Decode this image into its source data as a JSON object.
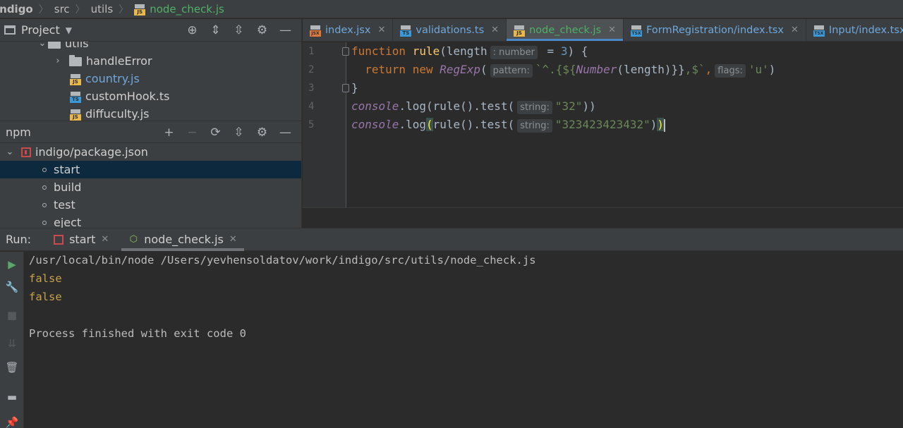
{
  "breadcrumb": {
    "items": [
      "indigo",
      "src",
      "utils",
      "node_check.js"
    ]
  },
  "project_panel": {
    "title": "Project",
    "tree": [
      {
        "label": "utils",
        "type": "folder"
      },
      {
        "label": "handleError",
        "type": "folder"
      },
      {
        "label": "country.js",
        "type": "js"
      },
      {
        "label": "customHook.ts",
        "type": "ts"
      },
      {
        "label": "diffuculty.js",
        "type": "js"
      }
    ]
  },
  "npm_panel": {
    "title": "npm",
    "package": "indigo/package.json",
    "scripts": [
      "start",
      "build",
      "test",
      "eject"
    ],
    "selected": "start"
  },
  "editor_tabs": [
    {
      "label": "index.jsx",
      "icon": "jsx-file-icon",
      "active": false
    },
    {
      "label": "validations.ts",
      "icon": "ts-file-icon",
      "active": false
    },
    {
      "label": "node_check.js",
      "icon": "js-file-icon",
      "active": true
    },
    {
      "label": "FormRegistration/index.tsx",
      "icon": "tsx-file-icon",
      "active": false
    },
    {
      "label": "Input/index.tsx",
      "icon": "tsx-file-icon",
      "active": false
    }
  ],
  "code": {
    "line_numbers": [
      "1",
      "2",
      "3",
      "4",
      "5"
    ],
    "l1": {
      "kw": "function",
      "fn": "rule",
      "open": "(length",
      "hint": ": number",
      "rest": " = ",
      "num": "3",
      "close": ") {"
    },
    "l2": {
      "kw": "return new",
      "cls": "RegExp",
      "open": "(",
      "hint1": "pattern:",
      "t1": "`^.{${",
      "num_cls": "Number",
      "t2": "(length)}}",
      "t3": ",$`",
      "comma": ",",
      "hint2": "flags:",
      "flag": "'u'",
      "close": ")"
    },
    "l3": {
      "text": "}"
    },
    "l4": {
      "obj": "console",
      "dot_log": ".log(",
      "call": "rule",
      "mid": "().test(",
      "hint": "string:",
      "arg": "\"32\"",
      "close": "))"
    },
    "l5": {
      "obj": "console",
      "dot": ".log",
      "paren": "(",
      "call": "rule",
      "mid": "().test(",
      "hint": "string:",
      "arg": "\"323423423432\"",
      "close1": ")",
      "close2": ")"
    }
  },
  "run_panel": {
    "label": "Run:",
    "tabs": [
      {
        "label": "start",
        "active": false
      },
      {
        "label": "node_check.js",
        "active": true
      }
    ],
    "output": {
      "command": "/usr/local/bin/node /Users/yevhensoldatov/work/indigo/src/utils/node_check.js",
      "line1": "false",
      "line2": "false",
      "finish": "Process finished with exit code 0"
    }
  },
  "colors": {
    "background": "#2b2b2b",
    "panel": "#3c3f41",
    "accent": "#4a88c7",
    "active_file": "#4fb068",
    "selected_row": "#0d293e",
    "output_value": "#c8a24a"
  }
}
